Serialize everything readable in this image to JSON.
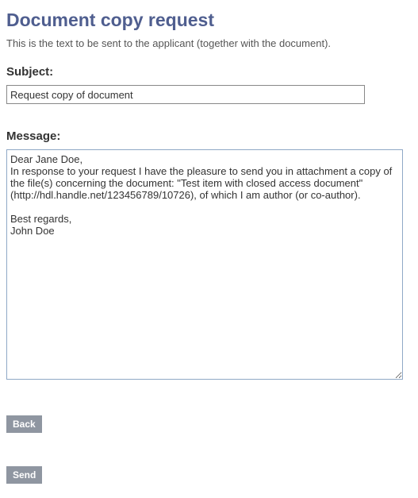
{
  "page": {
    "title": "Document copy request",
    "intro": "This is the text to be sent to the applicant (together with the document)."
  },
  "form": {
    "subject_label": "Subject:",
    "subject_value": "Request copy of document",
    "message_label": "Message:",
    "message_value": "Dear Jane Doe,\nIn response to your request I have the pleasure to send you in attachment a copy of the file(s) concerning the document: \"Test item with closed access document\" (http://hdl.handle.net/123456789/10726), of which I am author (or co-author).\n\nBest regards,\nJohn Doe"
  },
  "buttons": {
    "back": "Back",
    "send": "Send"
  }
}
